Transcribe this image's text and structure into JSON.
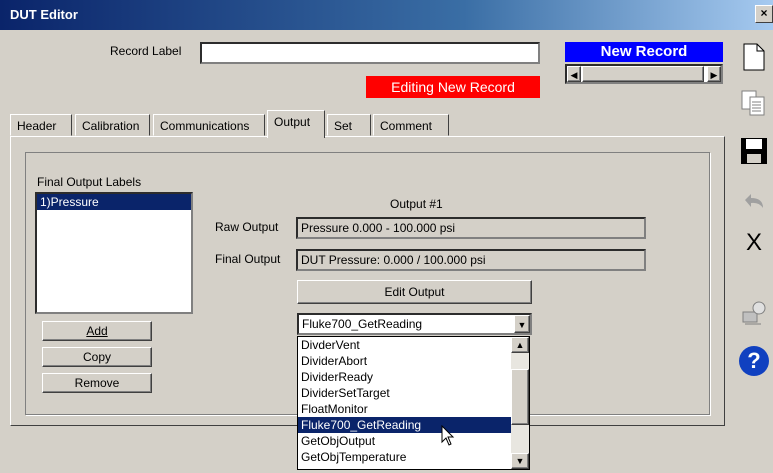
{
  "window": {
    "title": "DUT Editor"
  },
  "record": {
    "label_caption": "Record Label",
    "label_value": "",
    "status_badge": "Editing New Record",
    "new_record_badge": "New Record"
  },
  "tabs": [
    "Header",
    "Calibration",
    "Communications",
    "Output",
    "Set",
    "Comment"
  ],
  "active_tab": "Output",
  "output_panel": {
    "final_labels_caption": "Final Output Labels",
    "final_labels": [
      "1)Pressure"
    ],
    "output_title": "Output #1",
    "raw_output_label": "Raw Output",
    "raw_output_value": "Pressure 0.000 - 100.000 psi",
    "final_output_label": "Final Output",
    "final_output_value": "DUT Pressure: 0.000 / 100.000 psi",
    "edit_output_button": "Edit Output",
    "add_button": "Add",
    "copy_button": "Copy",
    "remove_button": "Remove"
  },
  "dropdown": {
    "selected": "Fluke700_GetReading",
    "options": [
      "DivderVent",
      "DividerAbort",
      "DividerReady",
      "DividerSetTarget",
      "FloatMonitor",
      "Fluke700_GetReading",
      "GetObjOutput",
      "GetObjTemperature"
    ],
    "highlighted": "Fluke700_GetReading"
  },
  "toolbar": {
    "icons": [
      "new-document-icon",
      "copy-icon",
      "save-icon",
      "undo-icon",
      "delete-icon",
      "run-icon",
      "help-icon"
    ],
    "delete_glyph": "X",
    "help_glyph": "?"
  },
  "colors": {
    "title_bar": "#0a246a",
    "status_badge": "#ff0000",
    "new_record_badge": "#0000ff",
    "selection": "#0a246a",
    "window_face": "#d4d0c8"
  }
}
